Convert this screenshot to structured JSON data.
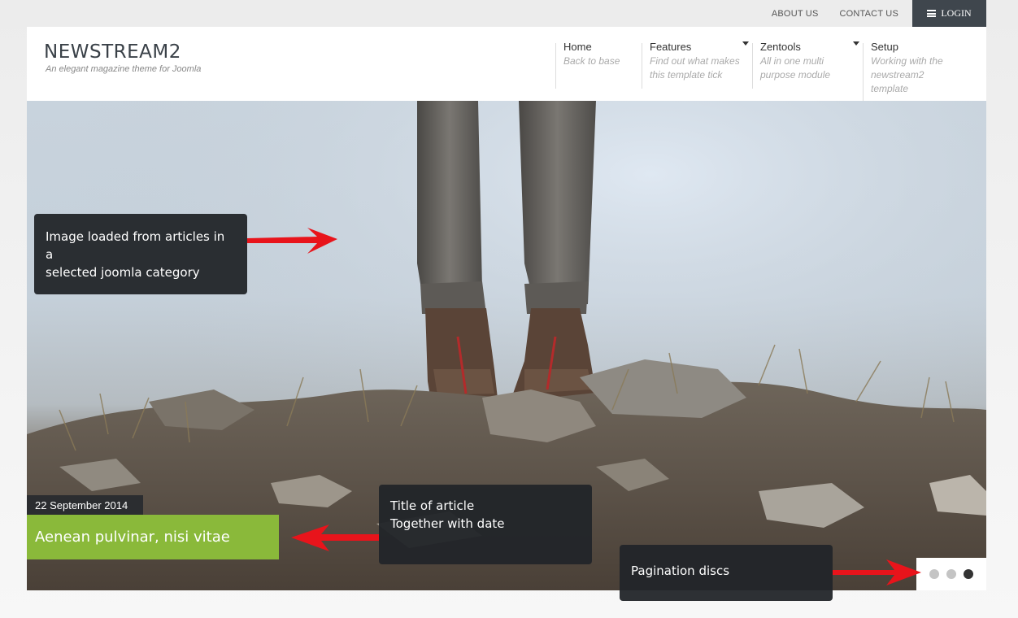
{
  "topbar": {
    "links": [
      "ABOUT US",
      "CONTACT US"
    ],
    "login_label": "LOGIN"
  },
  "header": {
    "site_title": "NEWSTREAM2",
    "tagline": "An elegant magazine theme for Joomla"
  },
  "nav": {
    "items": [
      {
        "label": "Home",
        "desc": [
          "Back to base"
        ]
      },
      {
        "label": "Features",
        "desc": [
          "Find out what makes",
          "this template tick"
        ]
      },
      {
        "label": "Zentools",
        "desc": [
          "All in one multi",
          "purpose module"
        ]
      },
      {
        "label": "Setup",
        "desc": [
          "Working with the",
          "newstream2",
          "template"
        ]
      }
    ]
  },
  "slide": {
    "date": "22 September 2014",
    "title": "Aenean pulvinar, nisi vitae",
    "pagination": {
      "total": 3,
      "active_index": 2
    }
  },
  "callouts": {
    "image": [
      "Image loaded from articles in a",
      "selected joomla category"
    ],
    "title": [
      "Title of article",
      "Together with date"
    ],
    "pagination": [
      "Pagination discs"
    ]
  },
  "colors": {
    "accent_green": "#8ab93a",
    "dark": "#3f464d",
    "arrow_red": "#e8141b"
  }
}
